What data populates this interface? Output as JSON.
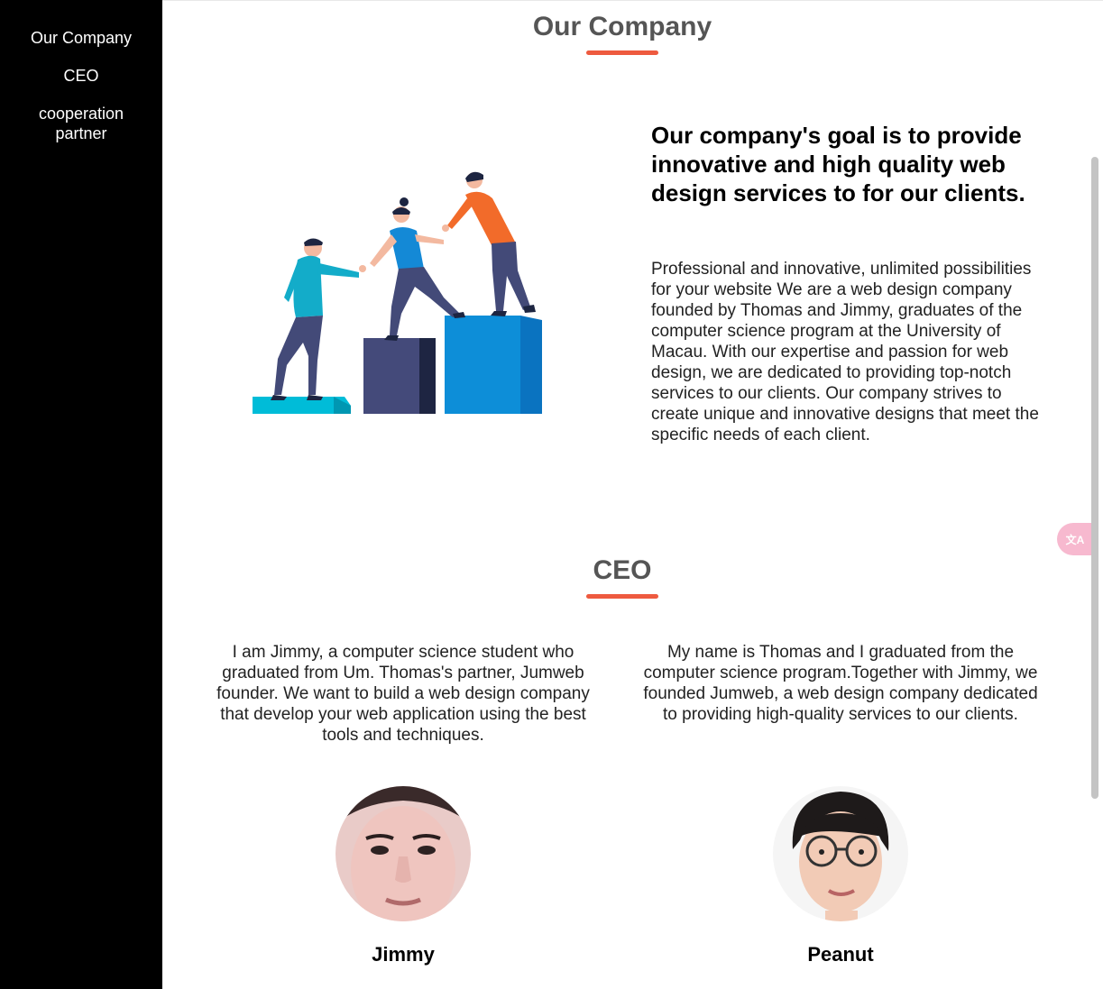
{
  "sidebar": {
    "items": [
      "Our Company",
      "CEO",
      "cooperation",
      "partner"
    ]
  },
  "company": {
    "title": "Our Company",
    "goal": "Our company's goal is to provide innovative and high quality web design services to for our clients.",
    "description": "Professional and innovative, unlimited possibilities for your website We are a web design company founded by Thomas and Jimmy, graduates of the computer science program at the University of Macau. With our expertise and passion for web design, we are dedicated to providing top-notch services to our clients. Our company strives to create unique and innovative designs that meet the specific needs of each client."
  },
  "ceo": {
    "title": "CEO",
    "people": [
      {
        "bio": "I am Jimmy, a computer science student who graduated from Um. Thomas's partner, Jumweb founder. We want to build a web design company that develop your web application using the best tools and techniques.",
        "name": "Jimmy"
      },
      {
        "bio": "My name is Thomas and I graduated from the computer science program.Together with Jimmy, we founded Jumweb, a web design company dedicated to providing high-quality services to our clients.",
        "name": "Peanut"
      }
    ]
  },
  "translate_button": {
    "label": "文A"
  },
  "colors": {
    "sidebar": "#000000",
    "accent": "#ee5a3f",
    "title": "#555555"
  }
}
